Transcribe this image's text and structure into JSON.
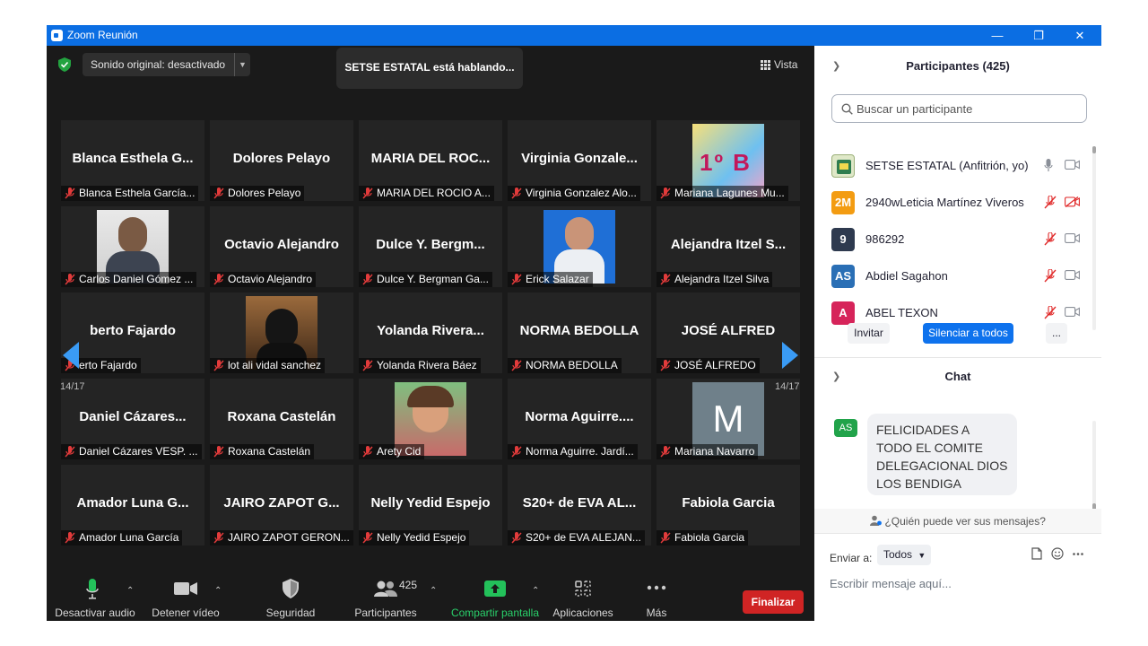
{
  "window": {
    "title": "Zoom Reunión",
    "minimize": "—",
    "restore": "❐",
    "close": "✕"
  },
  "top": {
    "audio_label": "Sonido original: desactivado",
    "speaking": "SETSE ESTATAL está hablando...",
    "view_label": "Vista"
  },
  "tiles": [
    {
      "big": "Blanca Esthela G...",
      "tag": "Blanca Esthela García..."
    },
    {
      "big": "Dolores Pelayo",
      "tag": "Dolores Pelayo"
    },
    {
      "big": "MARIA DEL ROC...",
      "tag": "MARIA DEL ROCIO A..."
    },
    {
      "big": "Virginia Gonzale...",
      "tag": "Virginia Gonzalez Alo..."
    },
    {
      "big": "",
      "tag": "Mariana Lagunes Mu..."
    },
    {
      "big": "",
      "tag": "Carlos Daniel Gómez ..."
    },
    {
      "big": "Octavio Alejandro",
      "tag": "Octavio Alejandro"
    },
    {
      "big": "Dulce Y. Bergm...",
      "tag": "Dulce Y. Bergman Ga..."
    },
    {
      "big": "",
      "tag": "Erick Salazar"
    },
    {
      "big": "Alejandra Itzel S...",
      "tag": "Alejandra Itzel Silva"
    },
    {
      "big": "berto Fajardo",
      "tag": "erto Fajardo"
    },
    {
      "big": "",
      "tag": "lot ali vidal sanchez"
    },
    {
      "big": "Yolanda Rivera...",
      "tag": "Yolanda Rivera Báez"
    },
    {
      "big": "NORMA BEDOLLA",
      "tag": "NORMA BEDOLLA"
    },
    {
      "big": "JOSÉ ALFRED",
      "tag": "JOSÉ ALFREDO"
    },
    {
      "big": "Daniel Cázares...",
      "tag": "Daniel Cázares VESP. ..."
    },
    {
      "big": "Roxana Castelán",
      "tag": "Roxana Castelán"
    },
    {
      "big": "",
      "tag": "Arety Cid"
    },
    {
      "big": "Norma Aguirre....",
      "tag": "Norma Aguirre. Jardí..."
    },
    {
      "big": "",
      "tag": "Mariana Navarro"
    },
    {
      "big": "Amador Luna G...",
      "tag": "Amador Luna García"
    },
    {
      "big": "JAIRO ZAPOT G...",
      "tag": "JAIRO ZAPOT GERON..."
    },
    {
      "big": "Nelly Yedid Espejo",
      "tag": "Nelly Yedid Espejo"
    },
    {
      "big": "S20+ de EVA AL...",
      "tag": "S20+ de EVA ALEJAN..."
    },
    {
      "big": "Fabiola Garcia",
      "tag": "Fabiola Garcia"
    }
  ],
  "photos": {
    "mariana_badge": "1º B",
    "navarro_letter": "M"
  },
  "pager": {
    "left": "14/17",
    "right": "14/17"
  },
  "toolbar": {
    "mute": "Desactivar audio",
    "video": "Detener vídeo",
    "security": "Seguridad",
    "participants": "Participantes",
    "participants_count": "425",
    "share": "Compartir pantalla",
    "apps": "Aplicaciones",
    "more": "Más",
    "end": "Finalizar"
  },
  "participants_panel": {
    "header": "Participantes (425)",
    "search_placeholder": "Buscar un participante",
    "list": [
      {
        "initials": "",
        "name": "SETSE ESTATAL (Anfitrión, yo)",
        "color": "#e8e8e8"
      },
      {
        "initials": "2M",
        "name": "2940wLeticia Martínez Viveros",
        "color": "#f39c12"
      },
      {
        "initials": "9",
        "name": "986292",
        "color": "#2e3a4f"
      },
      {
        "initials": "AS",
        "name": "Abdiel Sagahon",
        "color": "#2a6fb5"
      },
      {
        "initials": "A",
        "name": "ABEL TEXON",
        "color": "#d6245a"
      }
    ],
    "invite": "Invitar",
    "mute_all": "Silenciar a todos",
    "more": "..."
  },
  "chat": {
    "header": "Chat",
    "sender_initials": "AS",
    "message": "FELICIDADES A TODO EL COMITE DELEGACIONAL DIOS LOS BENDIGA",
    "who_can_see": "¿Quién puede ver sus mensajes?",
    "send_to_label": "Enviar a:",
    "send_to_value": "Todos",
    "input_placeholder": "Escribir mensaje aquí..."
  }
}
